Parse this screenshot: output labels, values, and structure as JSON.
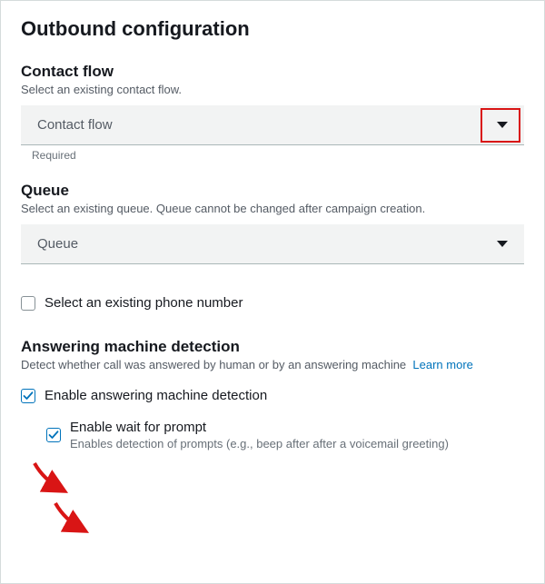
{
  "title": "Outbound configuration",
  "contactFlow": {
    "heading": "Contact flow",
    "description": "Select an existing contact flow.",
    "placeholder": "Contact flow",
    "hint": "Required"
  },
  "queue": {
    "heading": "Queue",
    "description": "Select an existing queue. Queue cannot be changed after campaign creation.",
    "placeholder": "Queue"
  },
  "phone": {
    "label": "Select an existing phone number"
  },
  "amd": {
    "heading": "Answering machine detection",
    "description": "Detect whether call was answered by human or by an answering machine",
    "learnMore": "Learn more",
    "enableLabel": "Enable answering machine detection",
    "waitLabel": "Enable wait for prompt",
    "waitDesc": "Enables detection of prompts (e.g., beep after after a voicemail greeting)"
  }
}
